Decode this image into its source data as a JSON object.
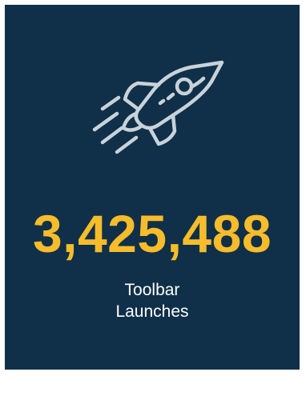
{
  "stat": {
    "value": "3,425,488",
    "label_line1": "Toolbar",
    "label_line2": "Launches",
    "icon": "rocket-icon"
  },
  "colors": {
    "background": "#0f3048",
    "value": "#f7bc2b",
    "label": "#ffffff",
    "icon": "#c9d2da"
  }
}
